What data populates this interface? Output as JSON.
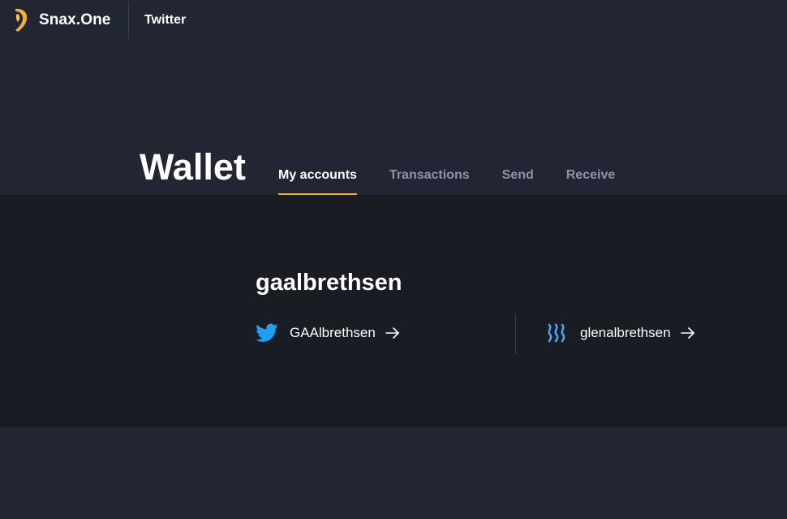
{
  "header": {
    "brand": "Snax.One",
    "link": "Twitter"
  },
  "wallet": {
    "title": "Wallet",
    "tabs": [
      {
        "label": "My accounts",
        "active": true
      },
      {
        "label": "Transactions",
        "active": false
      },
      {
        "label": "Send",
        "active": false
      },
      {
        "label": "Receive",
        "active": false
      }
    ]
  },
  "account": {
    "name": "gaalbrethsen",
    "links": [
      {
        "network": "twitter",
        "icon": "twitter-bird-icon",
        "handle": "GAAlbrethsen"
      },
      {
        "network": "steem",
        "icon": "steem-icon",
        "handle": "glenalbrethsen"
      }
    ]
  },
  "colors": {
    "background": "#222633",
    "panel": "#1a1c24",
    "accent": "#f2b02c",
    "twitter": "#1da1f2",
    "steem": "#4ba2f2",
    "inactive_tab": "#8d93a8"
  }
}
